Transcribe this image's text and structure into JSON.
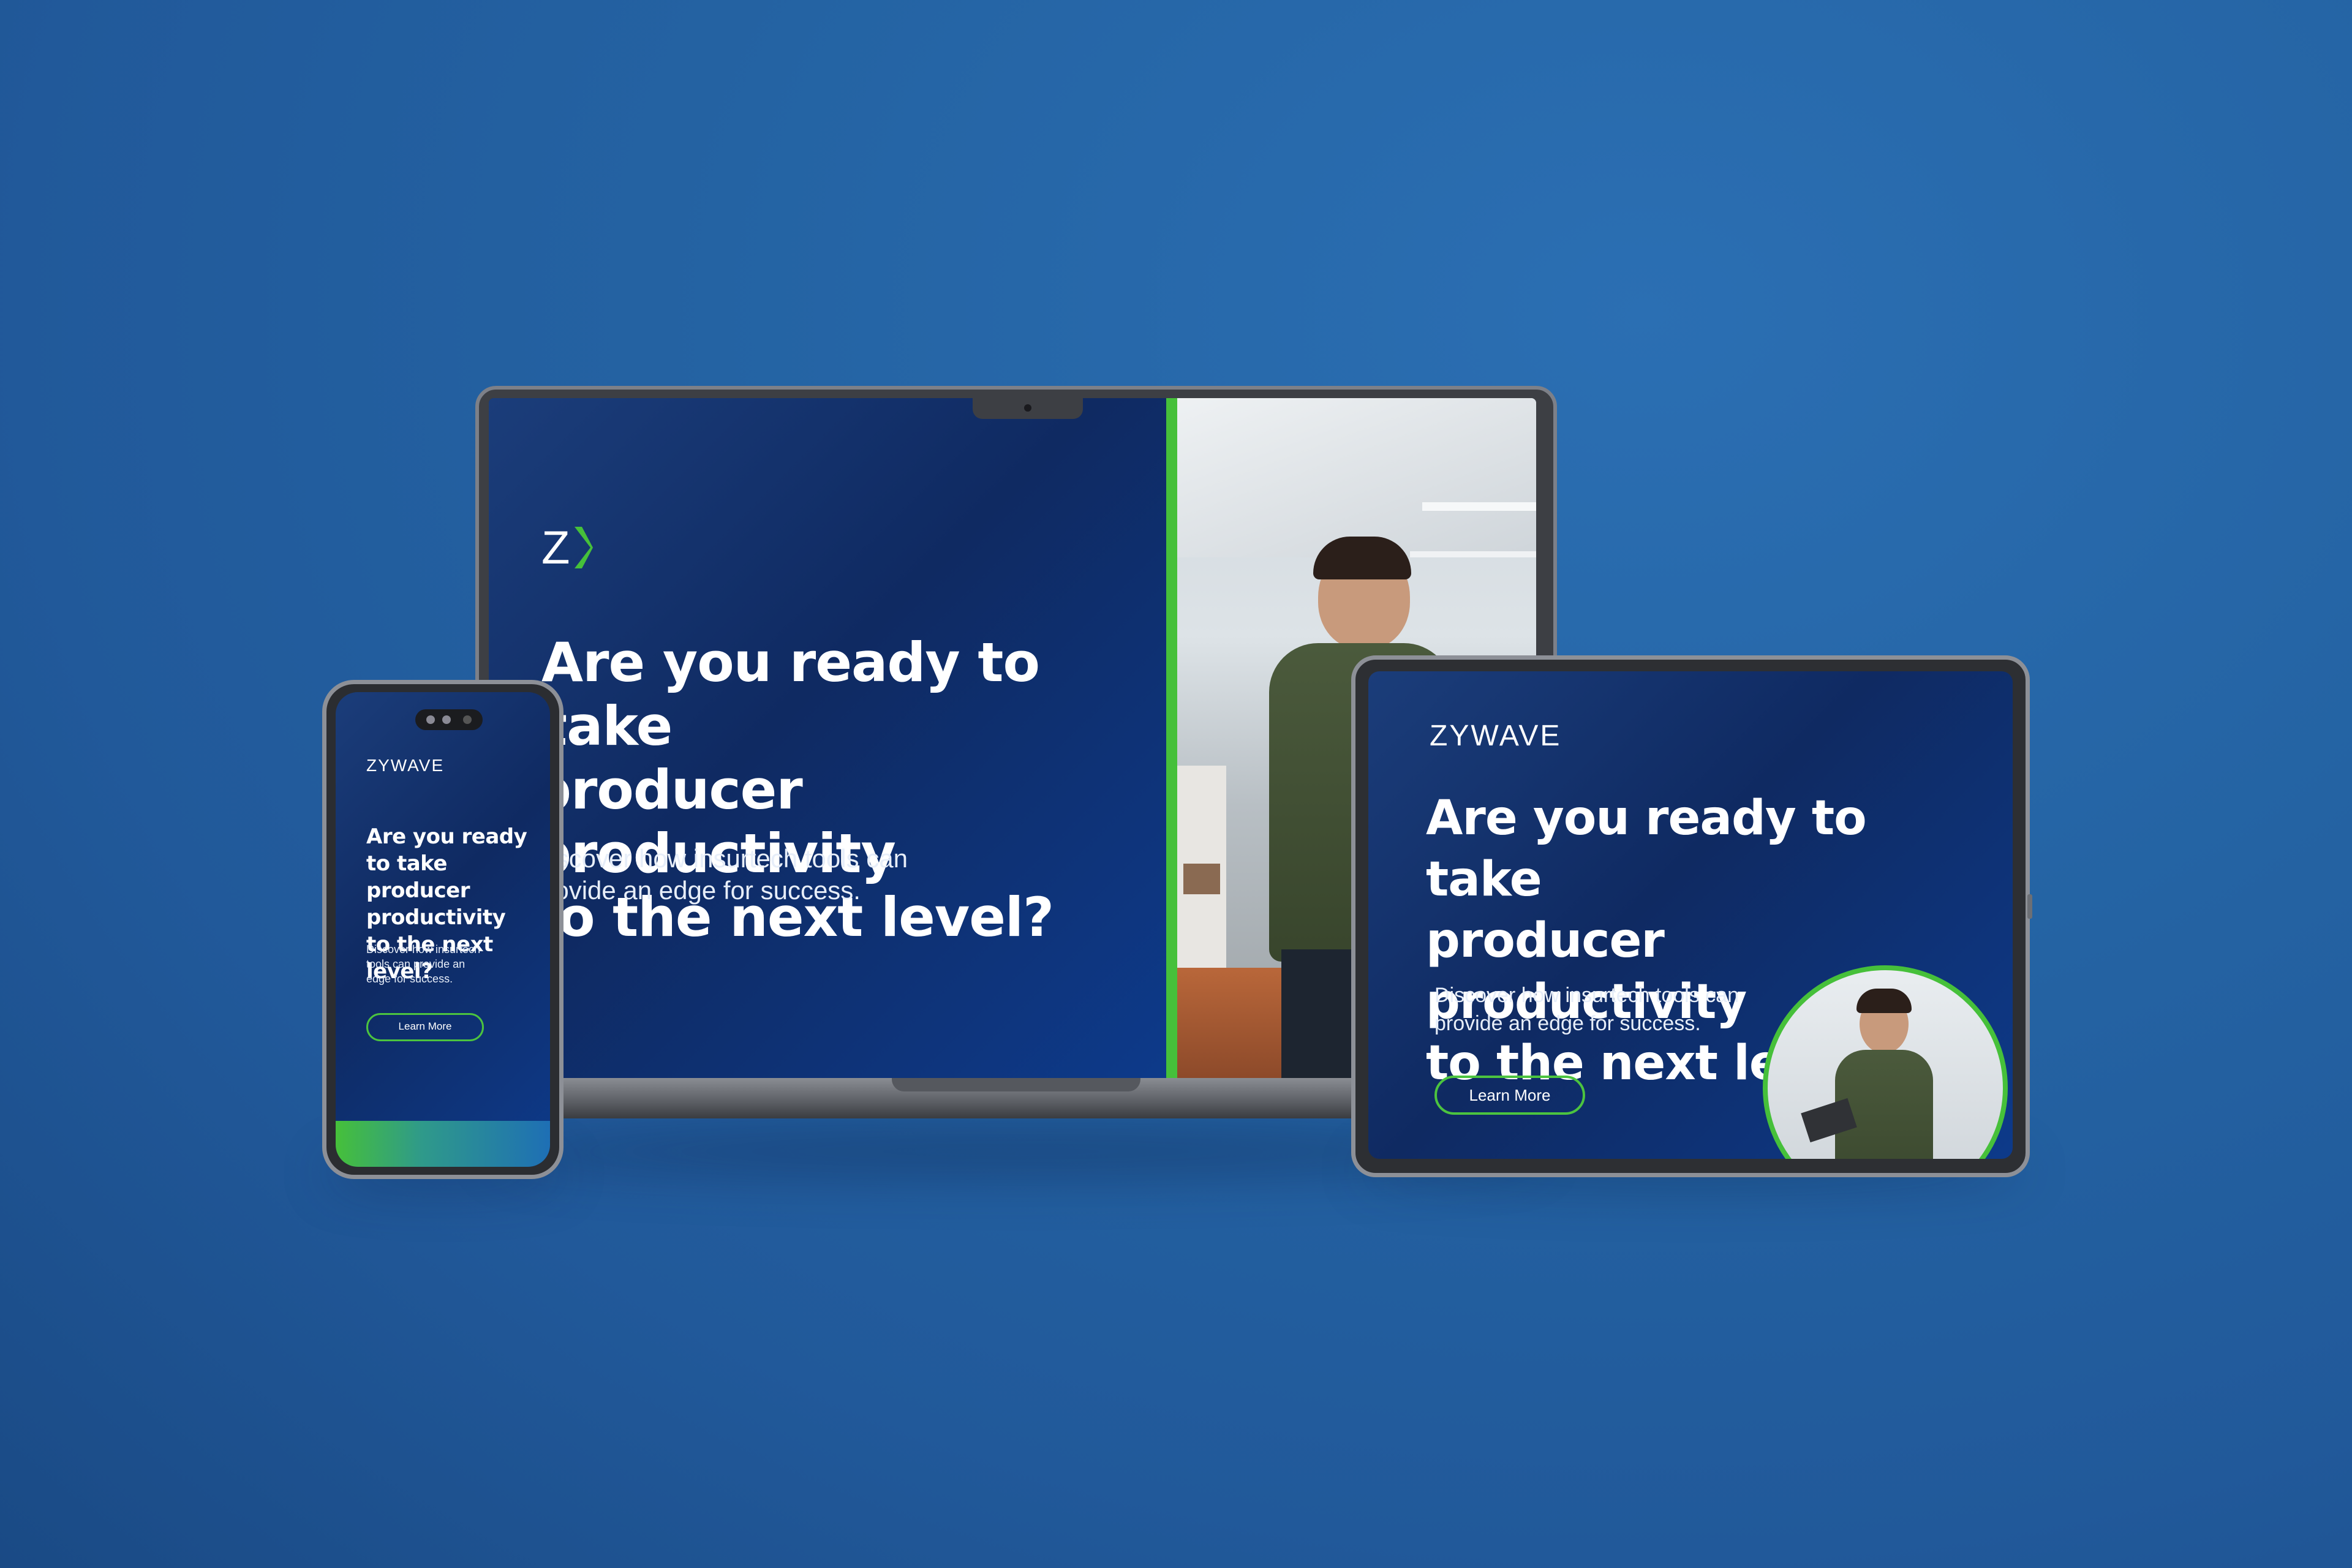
{
  "brand": {
    "name": "ZYWAVE",
    "logo_mark": "Z",
    "accent_green": "#46c03a",
    "navy": "#0f2a62",
    "background_blue": "#2463a3"
  },
  "ad": {
    "headline_line1": "Are you ready to take",
    "headline_line2": "producer productivity",
    "headline_line3": "to the next level?",
    "laptop_line2": "producer productivity",
    "laptop_line3": "to the next level?",
    "body_line1": "Discover how insurtech tools can",
    "body_line2": "provide an edge for success.",
    "cta_label": "Learn More"
  },
  "phone_ad": {
    "headline_line1": "Are you ready",
    "headline_line2": "to take producer",
    "headline_line3": "productivity",
    "headline_line4": "to the next level?",
    "body_line1": "Discover how insurtech",
    "body_line2": "tools can provide an",
    "body_line3": "edge for success."
  },
  "icons": {
    "logo": "zywave-logo-icon",
    "chevron": "chevron-right-icon",
    "camera": "camera-icon"
  }
}
